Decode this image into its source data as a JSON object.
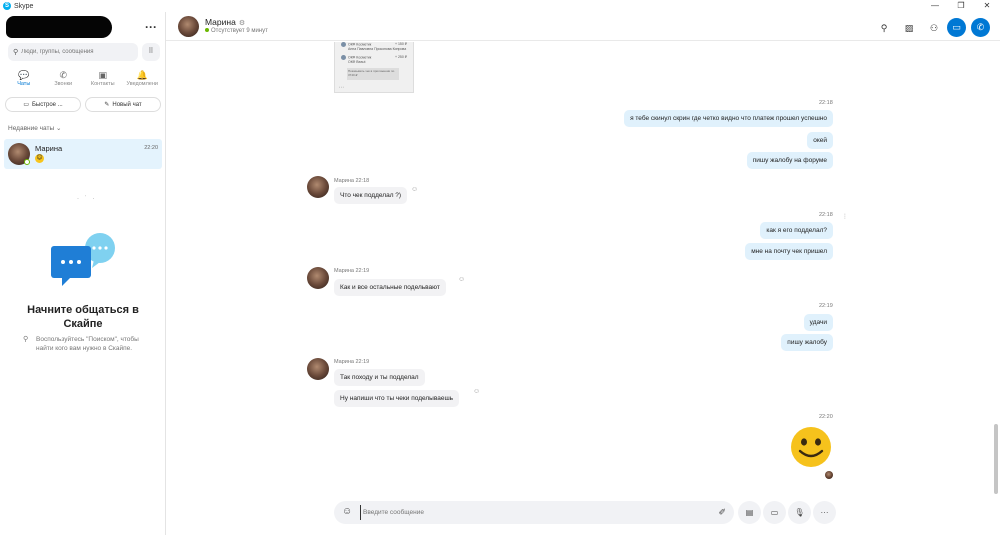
{
  "window": {
    "title": "Skype",
    "controls": [
      "—",
      "❐",
      "✕"
    ]
  },
  "sidebar": {
    "search_placeholder": "Люди, группы, сообщения",
    "tabs": [
      {
        "label": "Чаты",
        "icon": "chat-icon",
        "active": true
      },
      {
        "label": "Звонки",
        "icon": "phone-icon",
        "active": false
      },
      {
        "label": "Контакты",
        "icon": "contacts-icon",
        "active": false
      },
      {
        "label": "Уведомлени",
        "icon": "bell-icon",
        "active": false
      }
    ],
    "pills": [
      {
        "label": "Быстрое ..."
      },
      {
        "label": "Новый чат"
      }
    ],
    "recent_label": "Недавние чаты ⌄",
    "chat": {
      "name": "Марина",
      "time": "22:20",
      "preview": "😊"
    },
    "start_title": "Начните общаться в Скайпе",
    "start_hint": "Воспользуйтесь \"Поиском\", чтобы найти кого вам нужно в Скайпе."
  },
  "header": {
    "name": "Марина",
    "status": "Отсутствует 9 минут",
    "status_color": "#6bb700",
    "accent": "#0078d4"
  },
  "thumbnail": {
    "rows": [
      {
        "text": "ОКФ Косметик",
        "amount": "+ 150 ₽",
        "sub": "Анна Павловна Прокопова Кипрова"
      },
      {
        "text": "ОКФ Косметик",
        "amount": "+ 250 ₽",
        "sub": "ОКФ Beaut"
      }
    ],
    "note": "Показывать чек в приложении по 3740 ₽"
  },
  "messages": {
    "out1_time": "22:18",
    "out1": [
      "я тебе скинул скрин где четко видно что платеж прошел успешно",
      "окей",
      "пишу жалобу на форуме"
    ],
    "in1_meta": "Марина 22:18",
    "in1": [
      "Что чек подделал ?)"
    ],
    "out2_time": "22:18",
    "out2": [
      "как я его подделал?",
      "мне на почту чек пришел"
    ],
    "in2_meta": "Марина 22:19",
    "in2": [
      "Как и все остальные подельвают"
    ],
    "out3_time": "22:19",
    "out3": [
      "удачи",
      "пишу жалобу"
    ],
    "in3_meta": "Марина 22:19",
    "in3": [
      "Так походу и ты подделал",
      "Ну напиши что ты чеки поделываешь"
    ],
    "out4_time": "22:20"
  },
  "composer": {
    "placeholder": "Введите сообщение"
  }
}
